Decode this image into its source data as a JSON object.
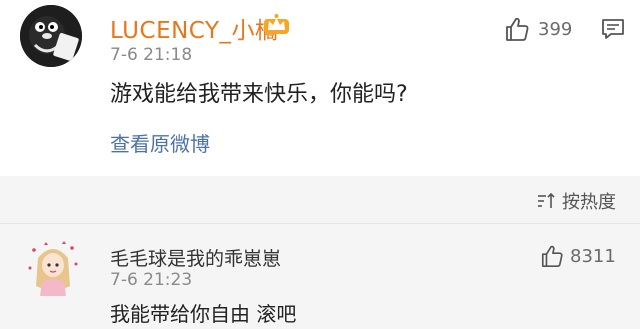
{
  "main_comment": {
    "username": "LUCENCY_小橘",
    "time": "7-6 21:18",
    "content": "游戏能给我带来快乐，你能吗?",
    "view_original": "查看原微博",
    "like_count": "399",
    "icons": {
      "avatar": "penguin-avatar",
      "badge": "crown-icon",
      "like": "thumbs-up-icon",
      "comment": "comment-icon"
    },
    "colors": {
      "username": "#e8761a",
      "link": "#4d73a6"
    }
  },
  "replies": {
    "sort_label": "按热度",
    "items": [
      {
        "username": "毛毛球是我的乖崽崽",
        "time": "7-6 21:23",
        "content": "我能带给你自由 滚吧",
        "like_count": "8311"
      }
    ],
    "icons": {
      "sort": "sort-icon",
      "avatar": "anime-girl-avatar",
      "like": "thumbs-up-icon"
    }
  }
}
